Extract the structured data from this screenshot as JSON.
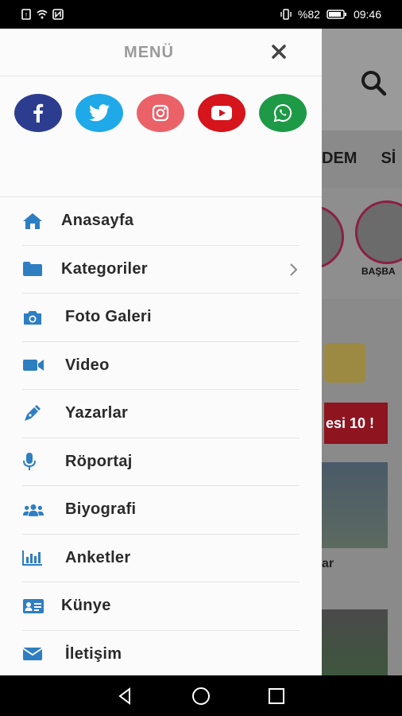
{
  "status_bar": {
    "battery_text": "%82",
    "time": "09:46"
  },
  "drawer": {
    "title": "MENÜ",
    "social": [
      {
        "name": "facebook",
        "color": "#2c3d8f"
      },
      {
        "name": "twitter",
        "color": "#1fa9e8"
      },
      {
        "name": "instagram",
        "color": "#eb6168"
      },
      {
        "name": "youtube",
        "color": "#d5141b"
      },
      {
        "name": "whatsapp",
        "color": "#1e9a47"
      }
    ],
    "items": [
      {
        "label": "Anasayfa",
        "icon": "home-icon"
      },
      {
        "label": "Kategoriler",
        "icon": "folder-icon",
        "has_submenu": true
      },
      {
        "label": "Foto Galeri",
        "icon": "camera-icon"
      },
      {
        "label": "Video",
        "icon": "video-camera-icon"
      },
      {
        "label": "Yazarlar",
        "icon": "pen-icon"
      },
      {
        "label": "Röportaj",
        "icon": "microphone-icon"
      },
      {
        "label": "Biyografi",
        "icon": "users-icon"
      },
      {
        "label": "Anketler",
        "icon": "bar-chart-icon"
      },
      {
        "label": "Künye",
        "icon": "id-card-icon"
      },
      {
        "label": "İletişim",
        "icon": "envelope-icon"
      }
    ],
    "icon_color": "#2e7ec2"
  },
  "background_page": {
    "tabs": [
      "DEM",
      "Sİ"
    ],
    "story_label": "BAŞBA",
    "banner_text": "esi 10 !",
    "article_snippet": "ar"
  }
}
